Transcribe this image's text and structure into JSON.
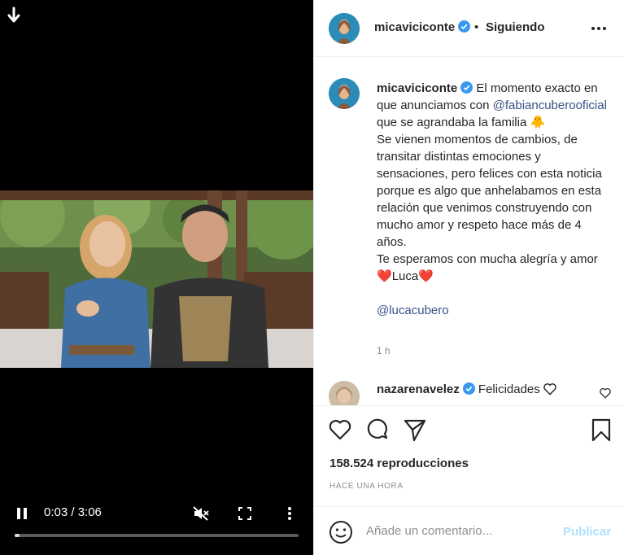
{
  "video": {
    "current_time": "0:03",
    "duration": "3:06",
    "time_display": "0:03 / 3:06",
    "progress_fraction": 0.016,
    "muted": true,
    "icons": [
      "download-arrow-icon",
      "pause-icon",
      "muted-speaker-icon",
      "fullscreen-icon",
      "more-vertical-icon"
    ]
  },
  "header": {
    "username": "micaviciconte",
    "separator": "•",
    "follow_status": "Siguiendo",
    "icons": [
      "verified-badge-icon",
      "more-horizontal-icon"
    ]
  },
  "caption": {
    "username": "micaviciconte",
    "text_1": "El momento exacto en que anunciamos con",
    "mention_1": "@fabiancuberooficial",
    "text_2": "que se agrandaba la familia",
    "emoji_1": "🐥",
    "text_3": "Se vienen momentos de cambios, de transitar distintas emociones y sensaciones, pero felices con esta noticia porque es algo que anhelabamos en esta relación que venimos construyendo con mucho amor y respeto hace más de 4 años.",
    "text_4": "Te esperamos con mucha alegría y amor",
    "heart": "❤️",
    "name_luca": "Luca",
    "mention_2": "@lucacubero",
    "time_ago": "1 h"
  },
  "comment": {
    "username": "nazarenavelez",
    "text": "Felicidades",
    "icons": [
      "verified-badge-icon",
      "heart-outline-icon",
      "like-comment-heart-icon"
    ]
  },
  "actions": {
    "views": "158.524 reproducciones",
    "posted_ago": "HACE UNA HORA",
    "icons": [
      "like-heart-icon",
      "comment-bubble-icon",
      "share-paper-plane-icon",
      "save-bookmark-icon"
    ]
  },
  "compose": {
    "placeholder": "Añade un comentario...",
    "publish_label": "Publicar",
    "icons": [
      "emoji-smiley-icon"
    ]
  },
  "colors": {
    "video_bg": "#000000",
    "text": "#262626",
    "muted_text": "#8e8e8e",
    "mention": "#385185",
    "verified": "#3897f0",
    "publish_disabled": "#b2dffc",
    "heart_red": "#e0245e"
  }
}
